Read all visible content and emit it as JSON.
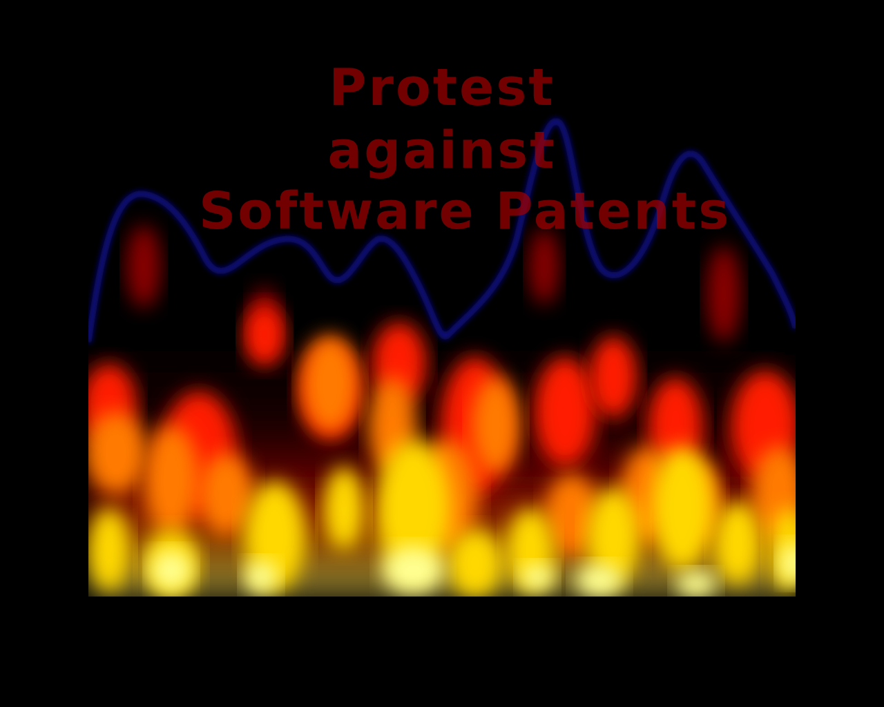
{
  "screen": {
    "background_color": "#000000"
  },
  "banner": {
    "line1": "Protest",
    "line2": "against",
    "line3": "Software Patents",
    "text_color": "#a00000"
  },
  "effect": {
    "name": "fire-visualization",
    "glow_line_color": "#0a0a8c",
    "palette": [
      "#000000",
      "#8a0000",
      "#ff1a00",
      "#ff7a00",
      "#ffd800",
      "#ffff90"
    ]
  }
}
